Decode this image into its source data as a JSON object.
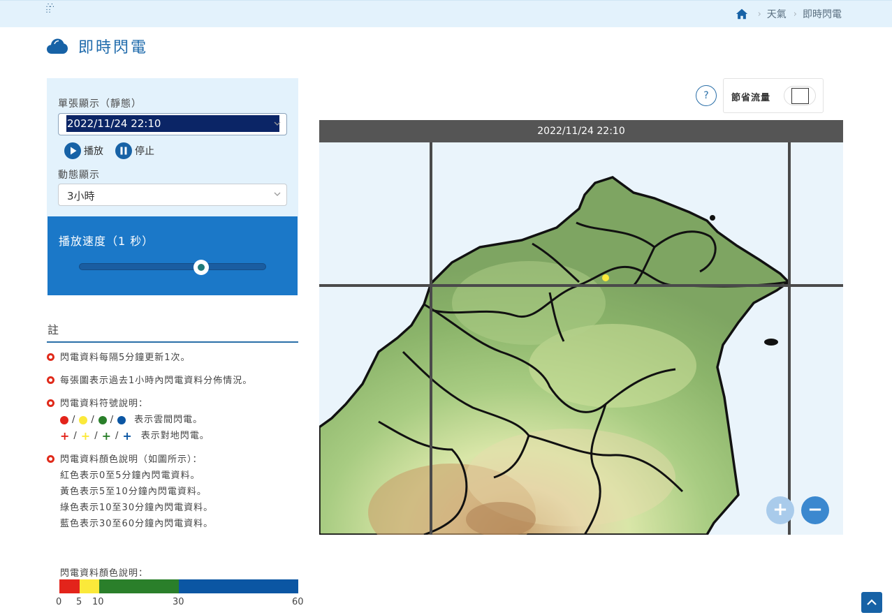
{
  "topbar": {
    "menu_icon": "grid-dots-icon",
    "breadcrumbs": [
      "天氣",
      "即時閃電"
    ]
  },
  "page": {
    "title": "即時閃電",
    "title_icon": "cloud-icon"
  },
  "controls": {
    "single_label": "單張顯示（靜態）",
    "single_value": "2022/11/24 22:10",
    "play_label": "播放",
    "stop_label": "停止",
    "dynamic_label": "動態顯示",
    "dynamic_value": "3小時",
    "speed_label": "播放速度（1 秒）",
    "speed_slider_fraction": 0.65
  },
  "notes": {
    "heading": "註",
    "n1": "閃電資料每隔5分鐘更新1次。",
    "n2": "每張圖表示過去1小時內閃電資料分佈情況。",
    "n3": "閃電資料符號說明：",
    "n3_cloud": "表示雲間閃電。",
    "n3_ground": "表示對地閃電。",
    "n4": "閃電資料顏色說明（如圖所示）：",
    "n4_red": "紅色表示0至5分鐘內閃電資料。",
    "n4_yellow": "黃色表示5至10分鐘內閃電資料。",
    "n4_green": "綠色表示10至30分鐘內閃電資料。",
    "n4_blue": "藍色表示30至60分鐘內閃電資料。"
  },
  "scale": {
    "label": "閃電資料顏色說明：",
    "ticks": [
      "0",
      "5",
      "10",
      "30",
      "60"
    ],
    "colors": {
      "red": "#e3241b",
      "yellow": "#fbe93a",
      "green": "#2a7f2a",
      "blue": "#0b56a3"
    }
  },
  "map": {
    "timestamp": "2022/11/24 22:10",
    "help": "?",
    "saver_label": "節省流量",
    "zoom_in": "+",
    "zoom_out": "−"
  }
}
